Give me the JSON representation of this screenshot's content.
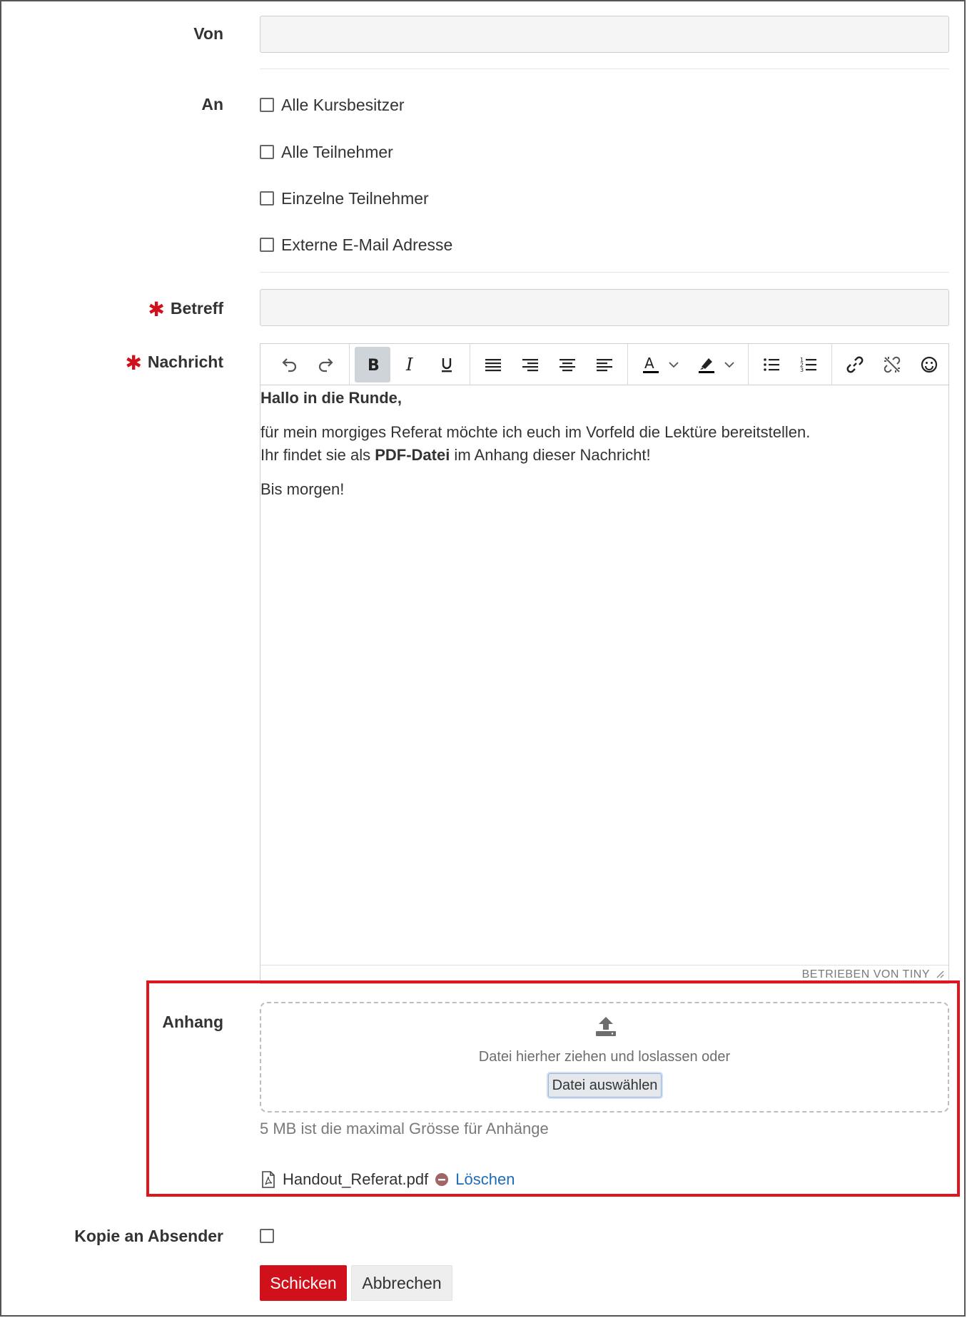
{
  "from": {
    "label": "Von",
    "value": ""
  },
  "to": {
    "label": "An",
    "options": [
      {
        "label": "Alle Kursbesitzer",
        "checked": false
      },
      {
        "label": "Alle Teilnehmer",
        "checked": false
      },
      {
        "label": "Einzelne Teilnehmer",
        "checked": false
      },
      {
        "label": "Externe E-Mail Adresse",
        "checked": false
      }
    ]
  },
  "subject": {
    "label": "Betreff",
    "required": true,
    "value": ""
  },
  "message": {
    "label": "Nachricht",
    "required": true,
    "toolbar": {
      "icons": [
        "undo-icon",
        "redo-icon",
        "bold-icon",
        "italic-icon",
        "underline-icon",
        "align-justify-icon",
        "align-right-icon",
        "align-center-icon",
        "align-left-icon",
        "text-color-icon",
        "highlight-color-icon",
        "bullet-list-icon",
        "numbered-list-icon",
        "link-icon",
        "unlink-icon",
        "emoji-icon"
      ],
      "active": "bold-icon",
      "text_color": "#000000",
      "highlight_color": "#000000"
    },
    "body": {
      "greeting": "Hallo in die Runde,",
      "line1": "für mein morgiges Referat möchte ich euch im Vorfeld die Lektüre bereitstellen.",
      "line2_pre": "Ihr findet sie als ",
      "line2_bold": "PDF-Datei",
      "line2_post": " im Anhang dieser Nachricht!",
      "closing": "Bis morgen!"
    },
    "powered_by": "BETRIEBEN VON TINY"
  },
  "attachment": {
    "label": "Anhang",
    "dropzone_text": "Datei hierher ziehen und loslassen oder",
    "choose_button": "Datei auswählen",
    "hint": "5 MB ist die maximal Grösse für Anhänge",
    "file_name": "Handout_Referat.pdf",
    "delete_label": "Löschen"
  },
  "copy_to_sender": {
    "label": "Kopie an Absender",
    "checked": false
  },
  "actions": {
    "send": "Schicken",
    "cancel": "Abbrechen"
  },
  "colors": {
    "primary": "#d0101a",
    "link": "#1e6bb8",
    "highlight_border": "#e0161e"
  }
}
